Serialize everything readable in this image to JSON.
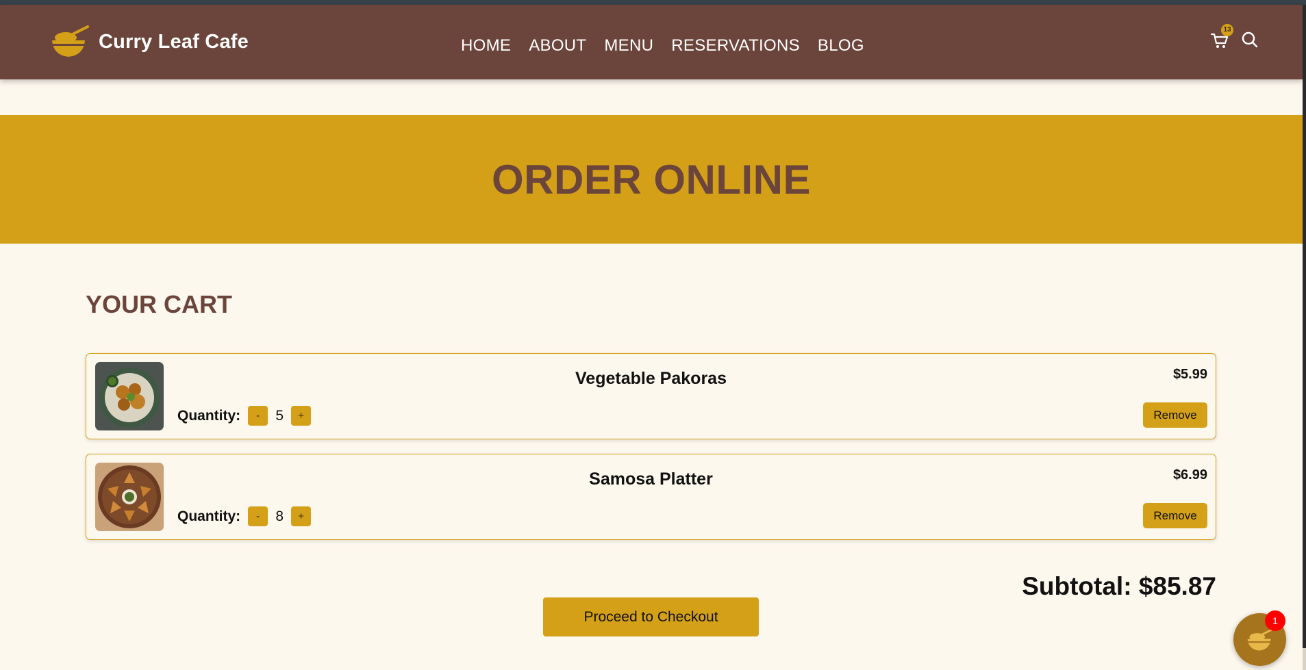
{
  "header": {
    "brand": "Curry Leaf Cafe",
    "nav": [
      "HOME",
      "ABOUT",
      "MENU",
      "RESERVATIONS",
      "BLOG"
    ],
    "cart_count": "13",
    "icons": [
      "bowl-logo-icon",
      "cart-icon",
      "search-icon"
    ]
  },
  "hero": {
    "title": "ORDER ONLINE"
  },
  "cart": {
    "title": "YOUR CART",
    "quantity_label": "Quantity:",
    "minus_label": "-",
    "plus_label": "+",
    "remove_label": "Remove",
    "items": [
      {
        "name": "Vegetable Pakoras",
        "price": "$5.99",
        "quantity": "5"
      },
      {
        "name": "Samosa Platter",
        "price": "$6.99",
        "quantity": "8"
      }
    ],
    "subtotal": "Subtotal: $85.87",
    "checkout_label": "Proceed to Checkout"
  },
  "chat": {
    "badge": "1"
  },
  "colors": {
    "header": "#6b453b",
    "accent": "#d4a017",
    "background": "#fdf8ee",
    "badge": "#ff0000"
  }
}
